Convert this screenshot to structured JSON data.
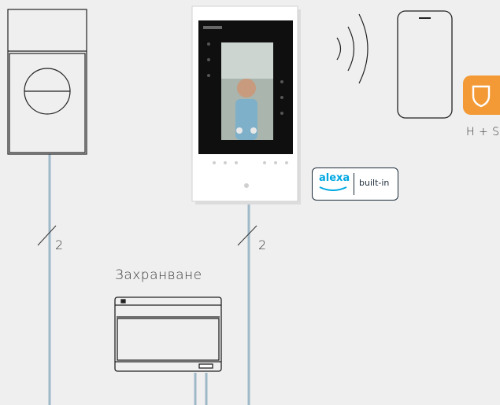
{
  "connections": {
    "door_station_wires": "2",
    "monitor_wires": "2"
  },
  "storage": {
    "label": "Захранване"
  },
  "alexa_badge": {
    "brand": "alexa",
    "text": "built-in",
    "color": "#00a8e1"
  },
  "app": {
    "label": "H + S",
    "icon": "shield-icon",
    "color": "#f39a37"
  },
  "colors": {
    "wire": "#9fb8c8",
    "background": "#efefef"
  }
}
